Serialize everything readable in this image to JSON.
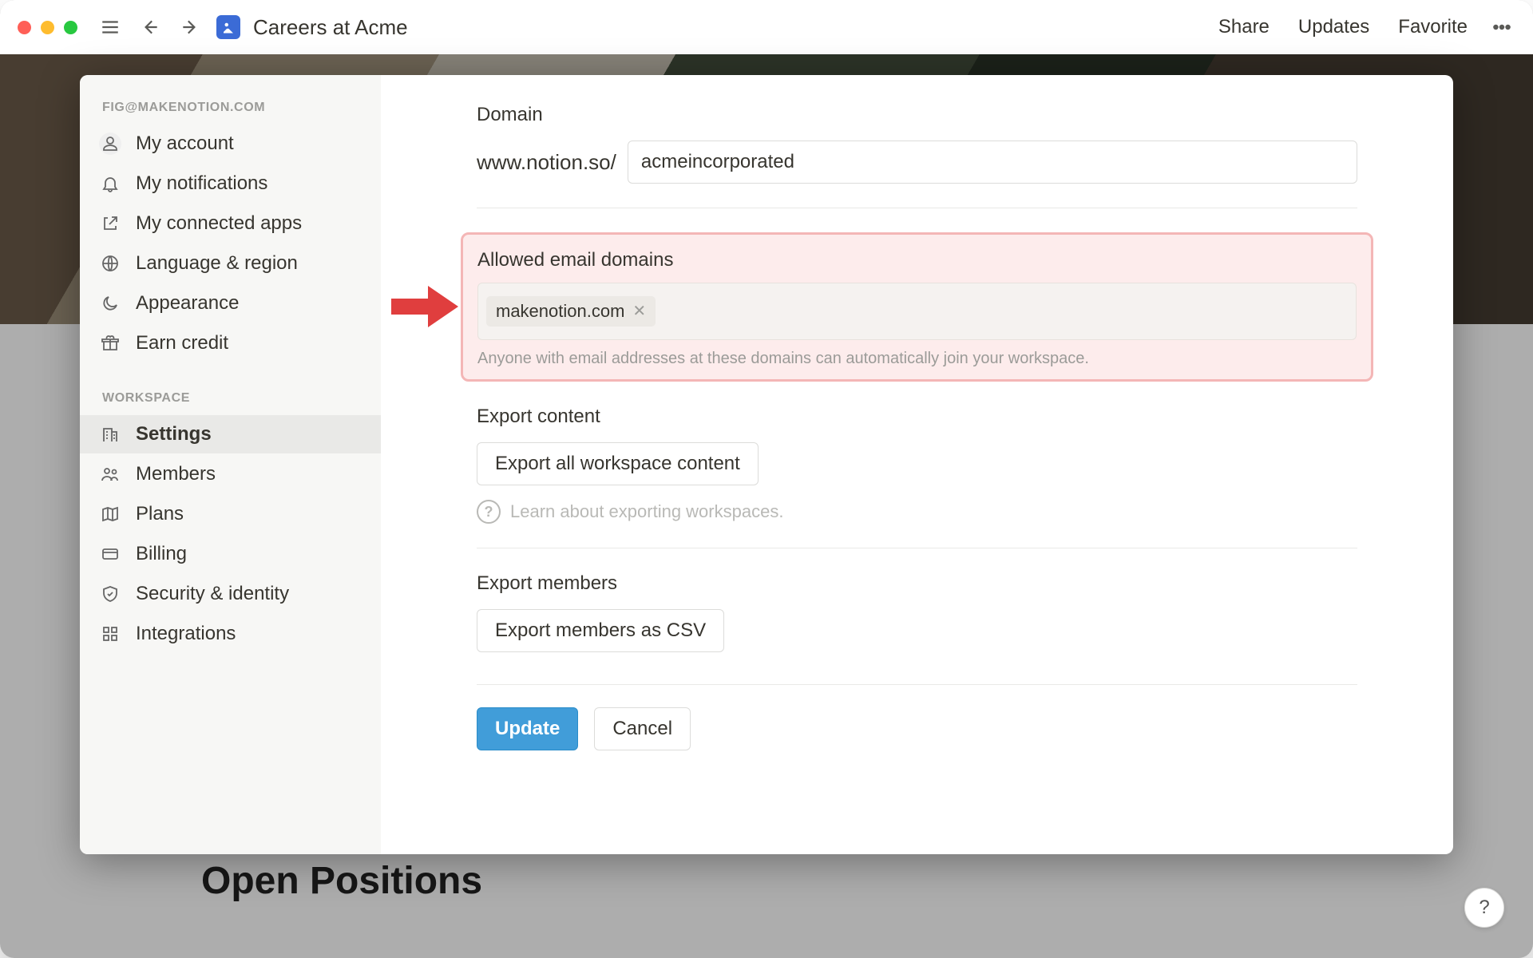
{
  "toolbar": {
    "page_title": "Careers at Acme",
    "share": "Share",
    "updates": "Updates",
    "favorite": "Favorite"
  },
  "background": {
    "page_heading": "Open Positions"
  },
  "sidebar": {
    "account_header": "FIG@MAKENOTION.COM",
    "workspace_header": "WORKSPACE",
    "account_items": [
      {
        "label": "My account"
      },
      {
        "label": "My notifications"
      },
      {
        "label": "My connected apps"
      },
      {
        "label": "Language & region"
      },
      {
        "label": "Appearance"
      },
      {
        "label": "Earn credit"
      }
    ],
    "workspace_items": [
      {
        "label": "Settings"
      },
      {
        "label": "Members"
      },
      {
        "label": "Plans"
      },
      {
        "label": "Billing"
      },
      {
        "label": "Security & identity"
      },
      {
        "label": "Integrations"
      }
    ]
  },
  "settings": {
    "domain": {
      "title": "Domain",
      "prefix": "www.notion.so/",
      "value": "acmeincorporated"
    },
    "allowed_email_domains": {
      "title": "Allowed email domains",
      "chips": [
        "makenotion.com"
      ],
      "help": "Anyone with email addresses at these domains can automatically join your workspace."
    },
    "export_content": {
      "title": "Export content",
      "button": "Export all workspace content",
      "learn": "Learn about exporting workspaces."
    },
    "export_members": {
      "title": "Export members",
      "button": "Export members as CSV"
    },
    "actions": {
      "update": "Update",
      "cancel": "Cancel"
    }
  },
  "help_button": "?"
}
